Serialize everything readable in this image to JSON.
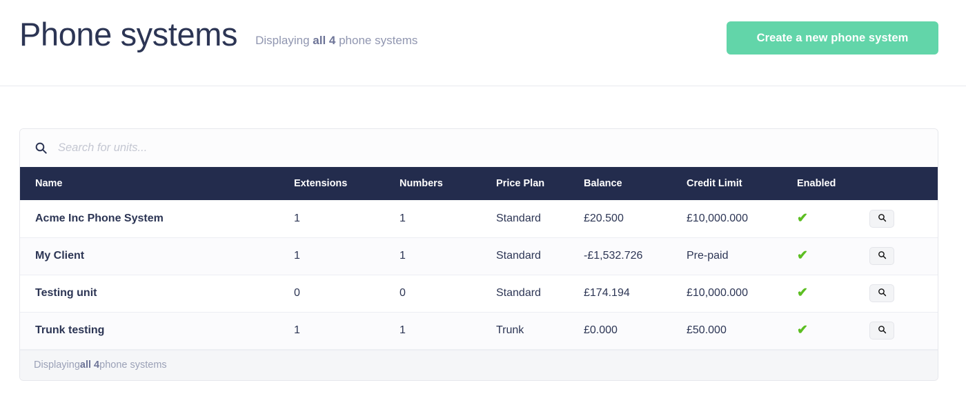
{
  "header": {
    "title": "Phone systems",
    "subtitle_prefix": "Displaying ",
    "subtitle_strong": "all 4",
    "subtitle_suffix": " phone systems",
    "create_button_label": "Create a new phone system",
    "accent_color": "#62d5a9",
    "title_color": "#2c3554"
  },
  "search": {
    "placeholder": "Search for units...",
    "value": "",
    "icon": "search-icon"
  },
  "table": {
    "header_bg": "#232c4d",
    "columns": [
      {
        "key": "name",
        "label": "Name"
      },
      {
        "key": "extensions",
        "label": "Extensions"
      },
      {
        "key": "numbers",
        "label": "Numbers"
      },
      {
        "key": "price_plan",
        "label": "Price Plan"
      },
      {
        "key": "balance",
        "label": "Balance"
      },
      {
        "key": "credit_limit",
        "label": "Credit Limit"
      },
      {
        "key": "enabled",
        "label": "Enabled"
      }
    ],
    "rows": [
      {
        "name": "Acme Inc Phone System",
        "extensions": "1",
        "numbers": "1",
        "price_plan": "Standard",
        "balance": "£20.500",
        "credit_limit": "£10,000.000",
        "enabled": "✔",
        "action_icon": "search-icon"
      },
      {
        "name": "My Client",
        "extensions": "1",
        "numbers": "1",
        "price_plan": "Standard",
        "balance": "-£1,532.726",
        "credit_limit": "Pre-paid",
        "enabled": "✔",
        "action_icon": "search-icon"
      },
      {
        "name": "Testing unit",
        "extensions": "0",
        "numbers": "0",
        "price_plan": "Standard",
        "balance": "£174.194",
        "credit_limit": "£10,000.000",
        "enabled": "✔",
        "action_icon": "search-icon"
      },
      {
        "name": "Trunk testing",
        "extensions": "1",
        "numbers": "1",
        "price_plan": "Trunk",
        "balance": "£0.000",
        "credit_limit": "£50.000",
        "enabled": "✔",
        "action_icon": "search-icon"
      }
    ],
    "enabled_check_color": "#5cbe22"
  },
  "footer": {
    "prefix": "Displaying ",
    "strong": "all 4",
    "suffix": " phone systems"
  }
}
